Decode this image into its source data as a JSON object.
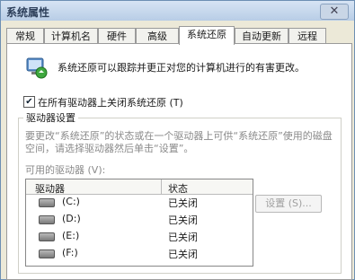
{
  "window": {
    "title": "系统属性",
    "close_glyph": "✕"
  },
  "tabs": [
    {
      "label": "常规"
    },
    {
      "label": "计算机名"
    },
    {
      "label": "硬件"
    },
    {
      "label": "高级"
    },
    {
      "label": "系统还原"
    },
    {
      "label": "自动更新"
    },
    {
      "label": "远程"
    }
  ],
  "active_tab": "系统还原",
  "panel": {
    "description": "系统还原可以跟踪并更正对您的计算机进行的有害更改。",
    "disable_all_checkbox": {
      "label": "在所有驱动器上关闭系统还原 (T)",
      "checked": true
    },
    "group_title": "驱动器设置",
    "hint": "要更改“系统还原”的状态或在一个驱动器上可供“系统还原”使用的磁盘空间，请选择驱动器然后单击“设置”。",
    "available_label": "可用的驱动器 (V):",
    "table": {
      "headers": [
        "驱动器",
        "状态"
      ],
      "rows": [
        {
          "drive": "(C:)",
          "status": "已关闭"
        },
        {
          "drive": "(D:)",
          "status": "已关闭"
        },
        {
          "drive": "(E:)",
          "status": "已关闭"
        },
        {
          "drive": "(F:)",
          "status": "已关闭"
        }
      ]
    },
    "settings_button": "设置 (S)..."
  },
  "colors": {
    "title_bar": "#c4d6ec",
    "disabled_text": "#8a8a8a"
  }
}
